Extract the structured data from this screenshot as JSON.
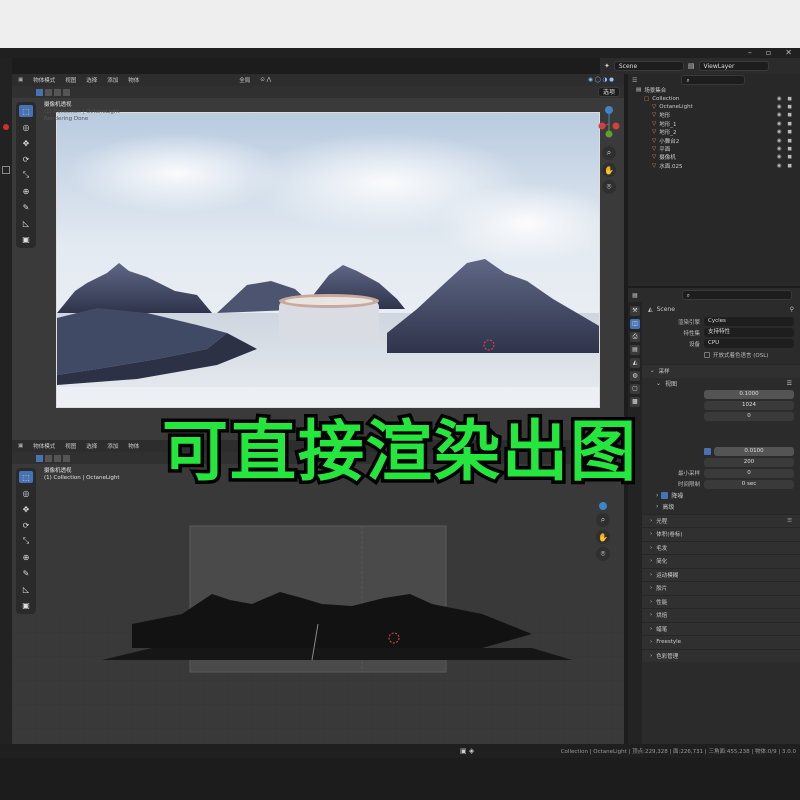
{
  "colors": {
    "accent_blue": "#4772b3",
    "overlay_green": "#25e63c",
    "light_orange": "#e0904a"
  },
  "window": {
    "minimize": "–",
    "maximize": "▫",
    "close": "✕"
  },
  "scene_bar": {
    "scene": "Scene",
    "view_layer": "ViewLayer"
  },
  "viewport_top": {
    "mode": "物体模式",
    "menus": [
      "视图",
      "选择",
      "添加",
      "物体"
    ],
    "transform": "全局",
    "options": "选项",
    "camera_title": "摄像机透视",
    "camera_sub": "(1) Collection | OctaneLight",
    "camera_status": "Rendering Done"
  },
  "viewport_bottom": {
    "mode": "物体模式",
    "menus": [
      "视图",
      "选择",
      "添加",
      "物体"
    ],
    "transform": "全局",
    "options": "选项",
    "camera_title": "摄像机透视",
    "camera_sub": "(1) Collection | OctaneLight"
  },
  "outliner": {
    "title": "场景集合",
    "items": [
      {
        "label": "Collection",
        "indent": 1
      },
      {
        "label": "OctaneLight",
        "indent": 2
      },
      {
        "label": "地形",
        "indent": 2
      },
      {
        "label": "地形_1",
        "indent": 2
      },
      {
        "label": "地形_2",
        "indent": 2
      },
      {
        "label": "小舞台2",
        "indent": 2
      },
      {
        "label": "平面",
        "indent": 2
      },
      {
        "label": "摄像机",
        "indent": 2
      },
      {
        "label": "水面.025",
        "indent": 2
      }
    ]
  },
  "properties": {
    "scene_name": "Scene",
    "render_engine_label": "渲染引擎",
    "render_engine": "Cycles",
    "feature_set_label": "特性集",
    "feature_set": "支持特性",
    "device_label": "设备",
    "device": "CPU",
    "osl_label": "开放式着色语言 (OSL)",
    "sampling": "采样",
    "viewport_sub": "视图",
    "viewport_values": [
      "0.1000",
      "1024",
      "0"
    ],
    "render_values": [
      "0.0100",
      "200",
      "0"
    ],
    "min_samples_label": "最小采样",
    "time_limit_label": "时间限制",
    "time_limit": "0 sec",
    "denoise_label": "降噪",
    "advanced_label": "高级",
    "sections": [
      "光程",
      "体积(卷标)",
      "毛发",
      "简化",
      "运动模糊",
      "胶片",
      "性能",
      "烘焙",
      "蜡笔",
      "Freestyle",
      "色彩管理"
    ]
  },
  "status": "Collection | OctaneLight | 顶点:229,328 | 面:226,731 | 三角面:455,238 | 物体:0/9 | 3.0.0",
  "overlay_text": "可直接渲染出图"
}
